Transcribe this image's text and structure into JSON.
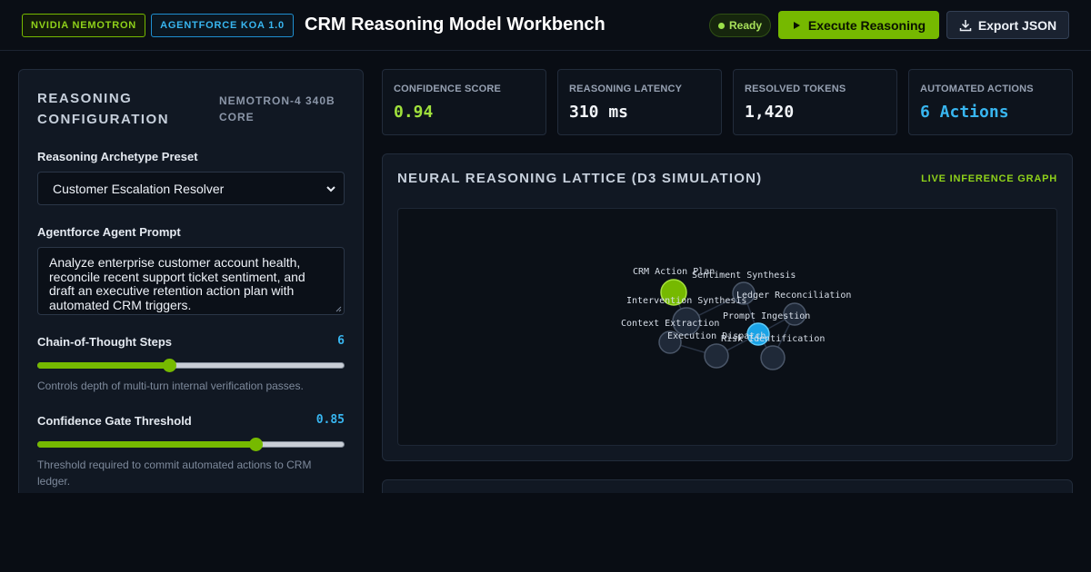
{
  "header": {
    "badges": [
      "NVIDIA NEMOTRON",
      "AGENTFORCE KOA 1.0"
    ],
    "title": "CRM Reasoning Model Workbench",
    "status": "Ready",
    "execute_label": "Execute Reasoning",
    "export_label": "Export JSON"
  },
  "config": {
    "title": "REASONING CONFIGURATION",
    "model": "NEMOTRON-4 340B CORE",
    "preset_label": "Reasoning Archetype Preset",
    "preset_value": "Customer Escalation Resolver",
    "prompt_label": "Agentforce Agent Prompt",
    "prompt_value": "Analyze enterprise customer account health, reconcile recent support ticket sentiment, and draft an executive retention action plan with automated CRM triggers.",
    "cot_label": "Chain-of-Thought Steps",
    "cot_value": "6",
    "cot_fraction": 0.43,
    "cot_hint": "Controls depth of multi-turn internal verification passes.",
    "threshold_label": "Confidence Gate Threshold",
    "threshold_value": "0.85",
    "threshold_fraction": 0.71,
    "threshold_hint": "Threshold required to commit automated actions to CRM ledger."
  },
  "metrics": [
    {
      "label": "CONFIDENCE SCORE",
      "value": "0.94",
      "color": "#9fe03c"
    },
    {
      "label": "REASONING LATENCY",
      "value": "310 ms",
      "color": "#f2f5f9"
    },
    {
      "label": "RESOLVED TOKENS",
      "value": "1,420",
      "color": "#f2f5f9"
    },
    {
      "label": "AUTOMATED ACTIONS",
      "value": "6 Actions",
      "color": "#38b6f0"
    }
  ],
  "lattice": {
    "title": "NEURAL REASONING LATTICE (D3 SIMULATION)",
    "tag": "LIVE INFERENCE GRAPH",
    "nodes": [
      {
        "label": "CRM Action Plan",
        "kind": "output"
      },
      {
        "label": "Sentiment Synthesis",
        "kind": "hidden"
      },
      {
        "label": "Intervention Synthesis",
        "kind": "hidden"
      },
      {
        "label": "Ledger Reconciliation",
        "kind": "hidden"
      },
      {
        "label": "Prompt Ingestion",
        "kind": "input"
      },
      {
        "label": "Context Extraction",
        "kind": "hidden"
      },
      {
        "label": "Execution Dispatch",
        "kind": "hidden"
      },
      {
        "label": "Risk Identification",
        "kind": "hidden"
      }
    ]
  }
}
